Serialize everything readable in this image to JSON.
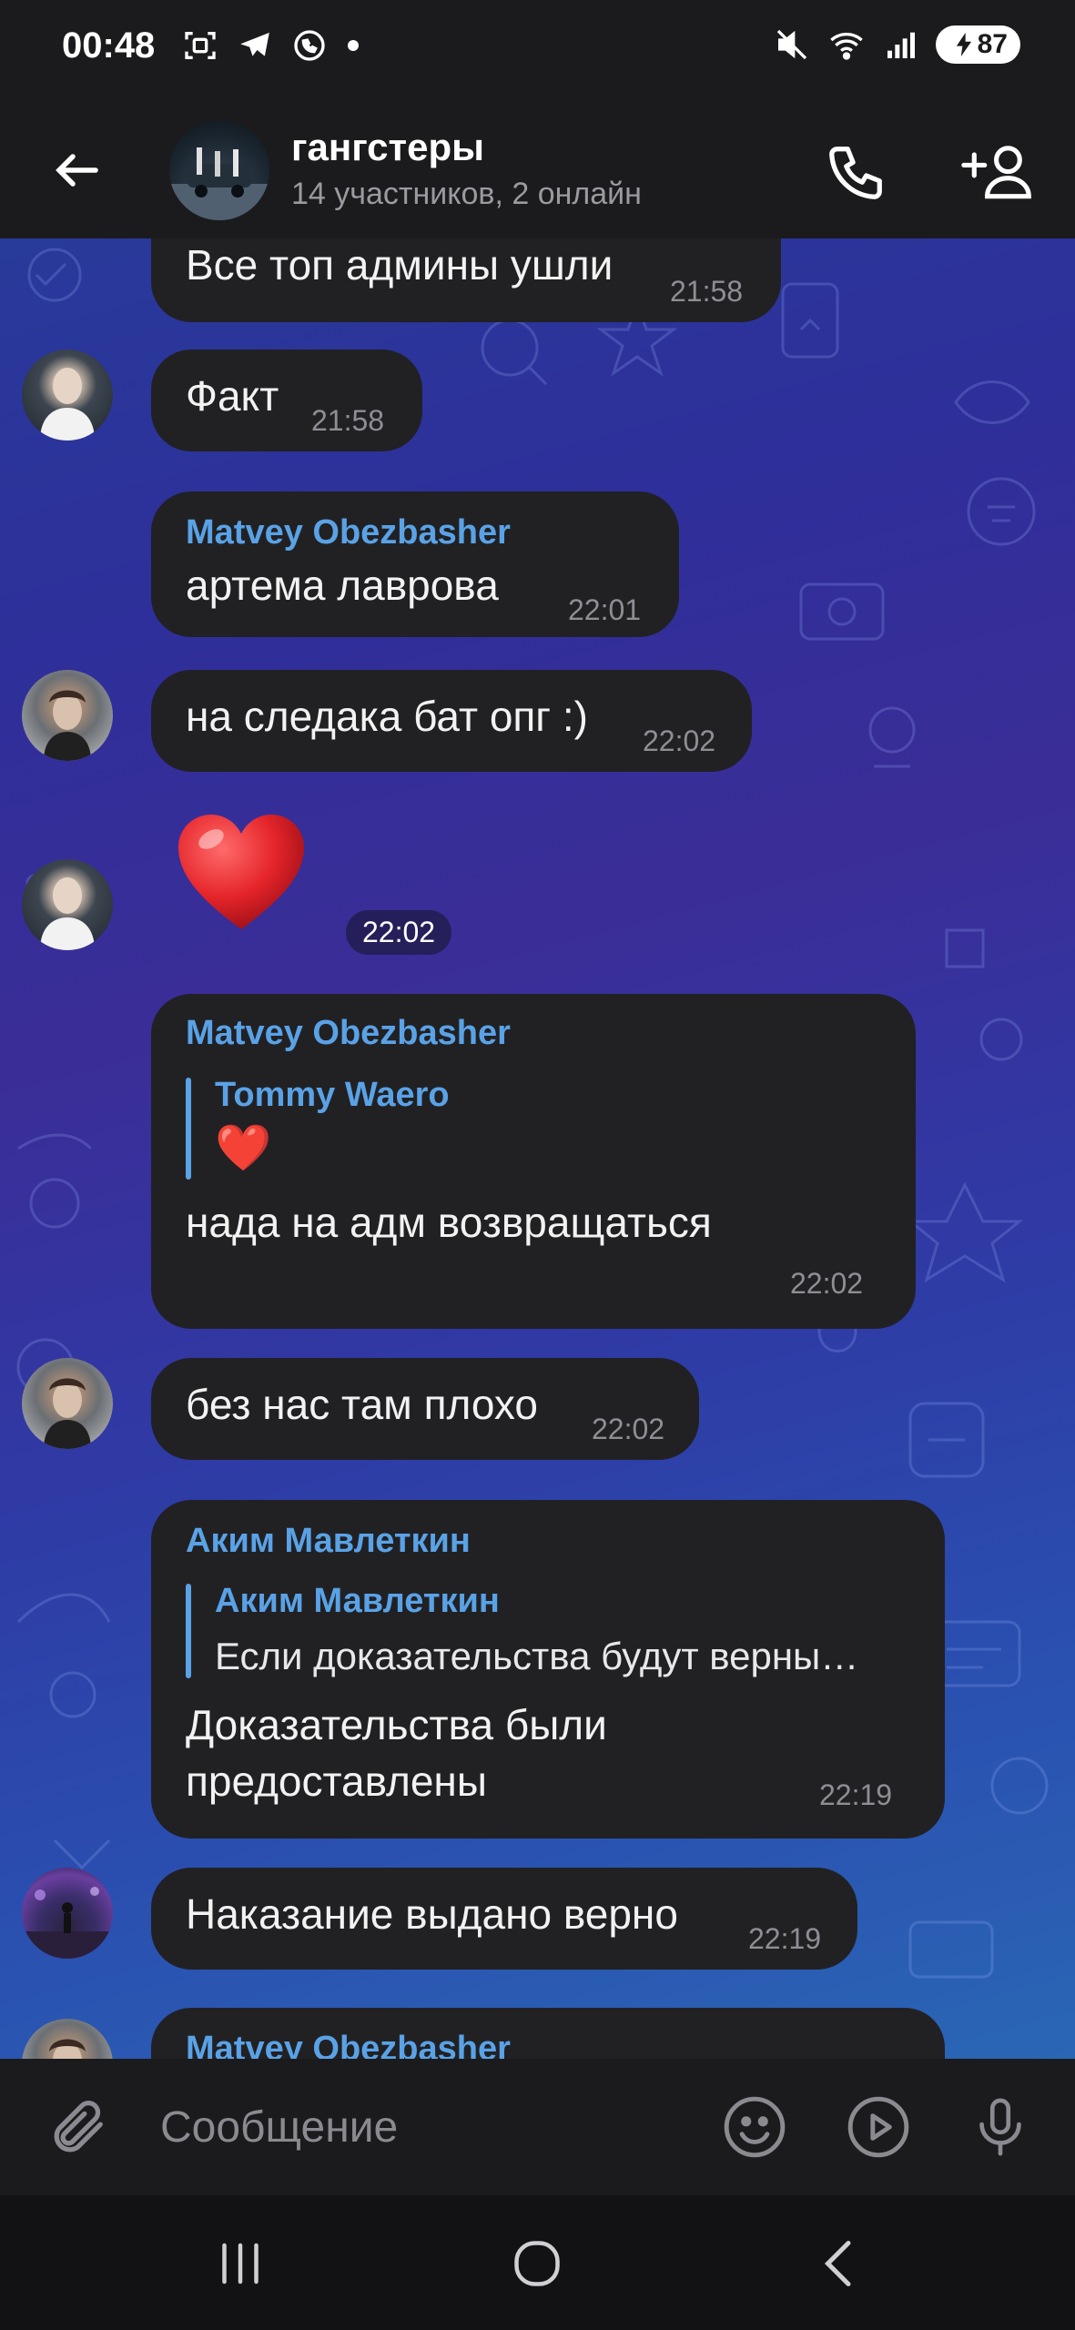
{
  "status_bar": {
    "time": "00:48",
    "battery": "87"
  },
  "header": {
    "title": "гангстеры",
    "subtitle": "14 участников, 2 онлайн"
  },
  "messages": [
    {
      "text": "Все топ админы ушли",
      "time": "21:58"
    },
    {
      "text": "Факт",
      "time": "21:58"
    },
    {
      "sender": "Matvey Obezbasher",
      "text": "артема лаврова",
      "time": "22:01"
    },
    {
      "text": "на следака бат опг :)",
      "time": "22:02"
    },
    {
      "emoji": "❤️",
      "time": "22:02"
    },
    {
      "sender": "Matvey Obezbasher",
      "reply_name": "Tommy Waero",
      "reply_text": "❤️",
      "text": "нада на адм возвращаться",
      "time": "22:02"
    },
    {
      "text": "без нас там плохо",
      "time": "22:02"
    },
    {
      "sender": "Аким Мавлеткин",
      "reply_name": "Аким Мавлеткин",
      "reply_text": "Если доказательства будут верны…",
      "text_line1": "Доказательства были",
      "text_line2": "предоставлены",
      "time": "22:19"
    },
    {
      "text": "Наказание выдано верно",
      "time": "22:19"
    },
    {
      "sender": "Matvey Obezbasher"
    }
  ],
  "input": {
    "placeholder": "Сообщение"
  },
  "colors": {
    "accent": "#5aa2e6",
    "bubble": "#212124",
    "bar": "#1b1b1d"
  }
}
